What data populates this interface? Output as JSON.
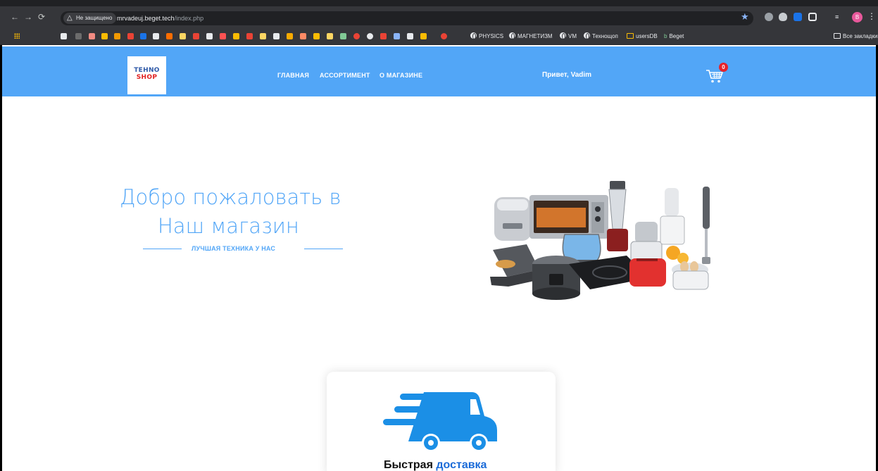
{
  "browser": {
    "security_label": "Не защищено",
    "url_host": "mrvadeuj.beget.tech",
    "url_path": "/index.php",
    "profile_initial": "B",
    "bookmarks": [
      {
        "label": "PHYSICS"
      },
      {
        "label": "МАГНЕТИЗМ"
      },
      {
        "label": "VM"
      },
      {
        "label": "Технощоп"
      },
      {
        "label": "usersDB"
      },
      {
        "label": "Beget"
      }
    ],
    "all_bookmarks": "Все закладки"
  },
  "site": {
    "logo_line1": "TEHNO",
    "logo_line2": "SHOP",
    "nav": {
      "home": "ГЛАВНАЯ",
      "catalog": "АССОРТИМЕНТ",
      "about": "О МАГАЗИНЕ"
    },
    "greeting": "Привет, Vadim",
    "cart_count": "0",
    "accent_color": "#52a6f7"
  },
  "hero": {
    "line1": "Добро пожаловать в",
    "line2": "Наш магазин",
    "subtitle": "ЛУЧШАЯ ТЕХНИКА У НАС"
  },
  "feature": {
    "title_word1": "Быстрая",
    "title_word2": "доставка",
    "icon": "delivery-truck-icon"
  }
}
